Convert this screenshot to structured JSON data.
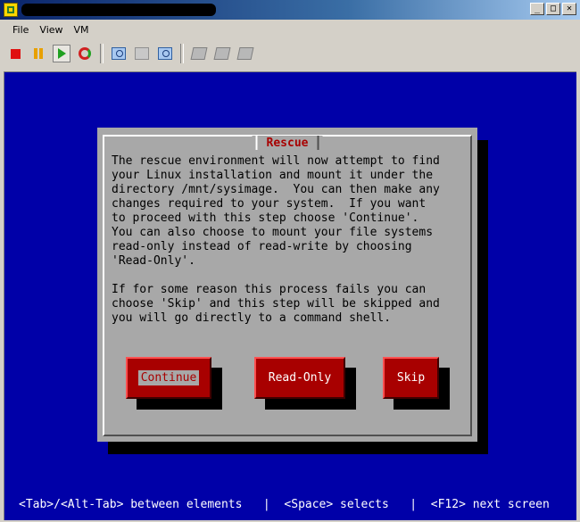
{
  "window": {
    "title": "",
    "controls": {
      "minimize": "_",
      "maximize": "□",
      "close": "✕"
    }
  },
  "menubar": {
    "items": [
      "File",
      "View",
      "VM"
    ]
  },
  "toolbar": {
    "buttons": [
      "stop-icon",
      "pause-icon",
      "play-icon",
      "reset-icon",
      "snapshot-icon",
      "revert-icon",
      "manage-snapshots-icon",
      "settings-icon",
      "tools-icon",
      "share-icon"
    ]
  },
  "dialog": {
    "title": "Rescue",
    "text": "The rescue environment will now attempt to find\nyour Linux installation and mount it under the\ndirectory /mnt/sysimage.  You can then make any\nchanges required to your system.  If you want\nto proceed with this step choose 'Continue'.\nYou can also choose to mount your file systems\nread-only instead of read-write by choosing\n'Read-Only'.\n\nIf for some reason this process fails you can\nchoose 'Skip' and this step will be skipped and\nyou will go directly to a command shell.",
    "buttons": {
      "continue": "Continue",
      "readonly": "Read-Only",
      "skip": "Skip"
    }
  },
  "statusbar": {
    "text": "<Tab>/<Alt-Tab> between elements   |  <Space> selects   |  <F12> next screen"
  },
  "colors": {
    "console_bg": "#0000a8",
    "dialog_bg": "#a8a8a8",
    "title_red": "#a80000",
    "button_red": "#a80000"
  }
}
